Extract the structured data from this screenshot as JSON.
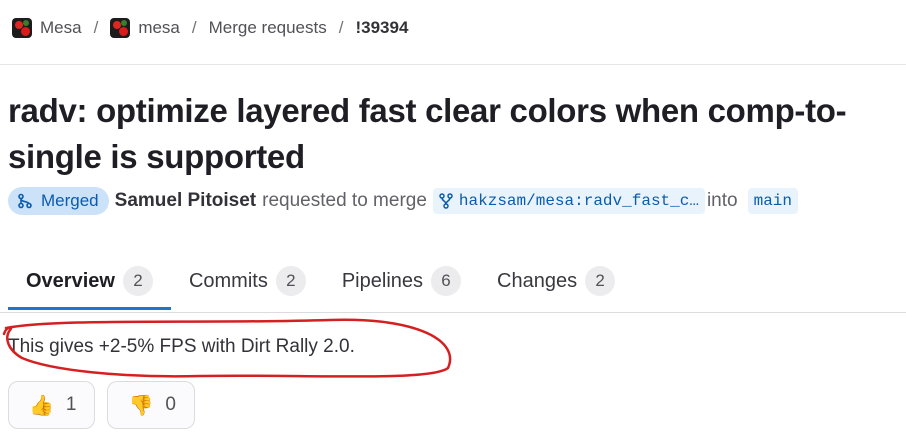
{
  "breadcrumb": {
    "items": [
      "Mesa",
      "mesa",
      "Merge requests"
    ],
    "current": "!39394",
    "separator": "/"
  },
  "title": "radv: optimize layered fast clear colors when comp-to-single is supported",
  "status": {
    "label": "Merged",
    "color": "#cbe2f9",
    "text_color": "#0b5cad",
    "icon": "merge-icon"
  },
  "meta": {
    "author": "Samuel Pitoiset",
    "action": "requested to merge",
    "source_branch": "hakzsam/mesa:radv_fast_c…",
    "into": "into",
    "target_branch": "main"
  },
  "tabs": [
    {
      "label": "Overview",
      "count": "2",
      "active": true
    },
    {
      "label": "Commits",
      "count": "2",
      "active": false
    },
    {
      "label": "Pipelines",
      "count": "6",
      "active": false
    },
    {
      "label": "Changes",
      "count": "2",
      "active": false
    }
  ],
  "description": "This gives +2-5% FPS with Dirt Rally 2.0.",
  "reactions": [
    {
      "emoji": "👍",
      "icon": "thumbs-up-icon",
      "count": "1"
    },
    {
      "emoji": "👎",
      "icon": "thumbs-down-icon",
      "count": "0"
    }
  ],
  "colors": {
    "accent": "#1f75cb",
    "annotation": "#d42020"
  }
}
